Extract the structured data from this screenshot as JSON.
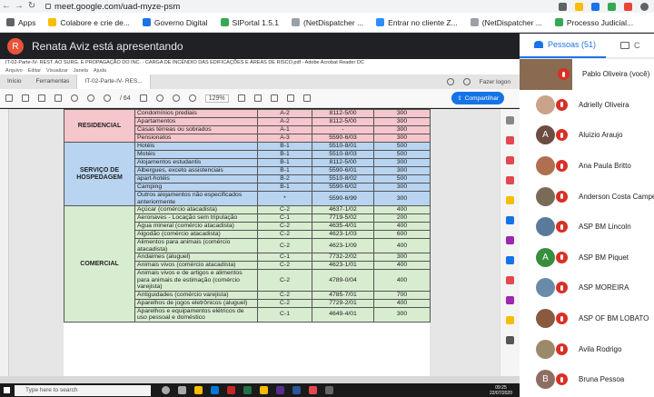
{
  "browser": {
    "url": "meet.google.com/uad-myze-psm",
    "bookmarks": [
      {
        "label": "Apps",
        "color": "#5f6368"
      },
      {
        "label": "Colabore e crie de...",
        "color": "#fbbc04"
      },
      {
        "label": "Governo Digital",
        "color": "#1a73e8"
      },
      {
        "label": "SIPortal 1.5.1",
        "color": "#34a853"
      },
      {
        "label": "(NetDispatcher ...",
        "color": "#9aa0a6"
      },
      {
        "label": "Entrar no cliente Z...",
        "color": "#2d8cff"
      },
      {
        "label": "(NetDispatcher ...",
        "color": "#9aa0a6"
      },
      {
        "label": "Processo Judicial...",
        "color": "#34a853"
      },
      {
        "label": "»",
        "color": "#ffffff"
      }
    ]
  },
  "meet": {
    "presenter_initial": "R",
    "presenter_text": "Renata Aviz está apresentando",
    "panel_tab_people": "Pessoas (51)",
    "panel_tab_chat": "C",
    "participants": [
      {
        "name": "Pablo Oliveira (você)",
        "initial": "",
        "color": "#8a6a50"
      },
      {
        "name": "Adrielly Oliveira",
        "initial": "",
        "color": "#c9a48a"
      },
      {
        "name": "Aluizio Araujo",
        "initial": "A",
        "color": "#6d4c41"
      },
      {
        "name": "Ana Paula Britto",
        "initial": "",
        "color": "#b07050"
      },
      {
        "name": "Anderson Costa Campe",
        "initial": "",
        "color": "#7a6a58"
      },
      {
        "name": "ASP BM Lincoln",
        "initial": "",
        "color": "#5a7a9a"
      },
      {
        "name": "ASP BM Piquet",
        "initial": "A",
        "color": "#388e3c"
      },
      {
        "name": "ASP MOREIRA",
        "initial": "",
        "color": "#6a8aaa"
      },
      {
        "name": "ASP OF BM LOBATO",
        "initial": "",
        "color": "#8a5a40"
      },
      {
        "name": "Avila Rodrigo",
        "initial": "",
        "color": "#9a8a6a"
      },
      {
        "name": "Bruna Pessoa",
        "initial": "B",
        "color": "#8d6e63"
      }
    ]
  },
  "acrobat": {
    "window_title": "IT-02-Parte-IV- REST. AO SURG. E PROPAGAÇÃO DO INC. - CARGA DE INCÊNDIO DAS EDIFICAÇÕES E ÁREAS DE RISCO.pdf - Adobe Acrobat Reader DC",
    "menu": [
      "Arquivo",
      "Editar",
      "Visualizar",
      "Janela",
      "Ajuda"
    ],
    "tabs": [
      "Início",
      "Ferramentas",
      "IT-02-Parte-IV- RES..."
    ],
    "login_label": "Fazer logon",
    "page_indicator": "/ 64",
    "zoom": "129%",
    "share_label": "Compartilhar"
  },
  "table": {
    "groups": [
      {
        "category": "RESIDENCIAL",
        "bg": "pink",
        "rows": [
          [
            "Condomínios prediais",
            "A-2",
            "8112-5/00",
            "300"
          ],
          [
            "Apartamentos",
            "A-2",
            "8112-5/00",
            "300"
          ],
          [
            "Casas térreas ou sobrados",
            "A-1",
            "-",
            "300"
          ],
          [
            "Pensionatos",
            "A-3",
            "5590-6/03",
            "300"
          ]
        ]
      },
      {
        "category": "SERVIÇO DE HOSPEDAGEM",
        "bg": "blue",
        "rows": [
          [
            "Hotéis",
            "B-1",
            "5510-8/01",
            "500"
          ],
          [
            "Motéis",
            "B-1",
            "5510-8/03",
            "500"
          ],
          [
            "Alojamentos estudantis",
            "B-1",
            "8112-5/00",
            "300"
          ],
          [
            "Albergues, exceto assistenciais",
            "B-1",
            "5590-6/01",
            "300"
          ],
          [
            "apart-hotéis",
            "B-2",
            "5510-8/02",
            "500"
          ],
          [
            "Camping",
            "B-1",
            "5590-6/02",
            "300"
          ],
          [
            "Outros alojamentos não especificados anteriormente",
            "*",
            "5590-6/99",
            "300"
          ]
        ]
      },
      {
        "category": "COMERCIAL",
        "bg": "green",
        "rows": [
          [
            "Açúcar (comércio atacadista)",
            "C-2",
            "4637-1/02",
            "400"
          ],
          [
            "Aeronaves - Locação sem tripulação",
            "C-1",
            "7719-5/02",
            "200"
          ],
          [
            "Água mineral (comércio atacadista)",
            "C-2",
            "4635-4/01",
            "400"
          ],
          [
            "Algodão (comércio atacadista)",
            "C-2",
            "4623-1/03",
            "600"
          ],
          [
            "Alimentos para animais (comércio atacadista)",
            "C-2",
            "4623-1/09",
            "400"
          ],
          [
            "Andaimes (aluguel)",
            "C-1",
            "7732-2/02",
            "300"
          ],
          [
            "Animais vivos (comércio atacadista)",
            "C-2",
            "4623-1/01",
            "400"
          ],
          [
            "Animais vivos e de artigos e alimentos para animais de estimação (comércio varejista)",
            "C-2",
            "4789-0/04",
            "400"
          ],
          [
            "Antiguidades (comércio varejista)",
            "C-2",
            "4785-7/01",
            "700"
          ],
          [
            "Aparelhos de jogos eletrônicos (aluguel)",
            "C-2",
            "7729-2/01",
            "400"
          ],
          [
            "Aparelhos e equipamentos elétricos de uso pessoal e doméstico",
            "C-1",
            "4649-4/01",
            "300"
          ]
        ]
      }
    ]
  },
  "windows": {
    "search_placeholder": "Type here to search",
    "time": "09:25",
    "date": "22/07/2020",
    "lang": "POR"
  }
}
